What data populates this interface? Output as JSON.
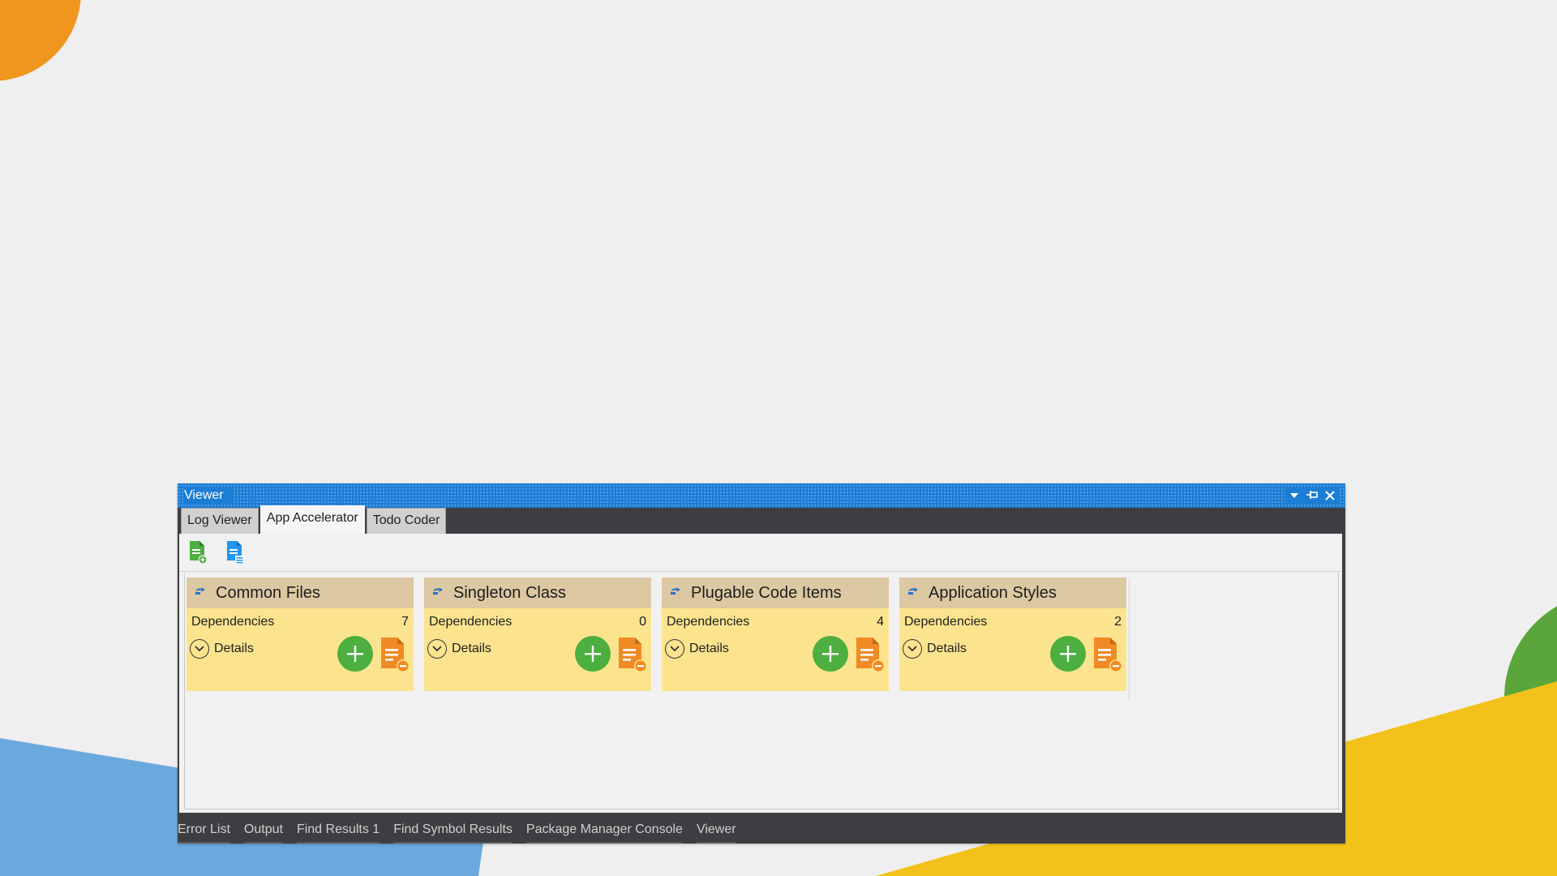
{
  "window": {
    "title": "Viewer",
    "controls": [
      "dropdown-icon",
      "pin-icon",
      "close-icon"
    ]
  },
  "tabs": [
    {
      "label": "Log Viewer",
      "active": false
    },
    {
      "label": "App Accelerator",
      "active": true
    },
    {
      "label": "Todo Coder",
      "active": false
    }
  ],
  "toolbar": {
    "buttons": [
      "add-file-icon",
      "file-list-icon"
    ]
  },
  "cards": [
    {
      "title": "Common Files",
      "dependencies_label": "Dependencies",
      "dependencies_count": "7",
      "details_label": "Details"
    },
    {
      "title": "Singleton Class",
      "dependencies_label": "Dependencies",
      "dependencies_count": "0",
      "details_label": "Details"
    },
    {
      "title": "Plugable Code Items",
      "dependencies_label": "Dependencies",
      "dependencies_count": "4",
      "details_label": "Details"
    },
    {
      "title": "Application Styles",
      "dependencies_label": "Dependencies",
      "dependencies_count": "2",
      "details_label": "Details"
    }
  ],
  "bottom_tabs": [
    {
      "label": "Error List"
    },
    {
      "label": "Output"
    },
    {
      "label": "Find Results 1"
    },
    {
      "label": "Find Symbol Results"
    },
    {
      "label": "Package Manager Console"
    },
    {
      "label": "Viewer"
    }
  ],
  "colors": {
    "titlebar": "#1c7dd5",
    "card_body": "#fce48f",
    "card_header": "#dcc8a2",
    "add_green": "#4caf3f",
    "file_orange": "#f08a24"
  }
}
